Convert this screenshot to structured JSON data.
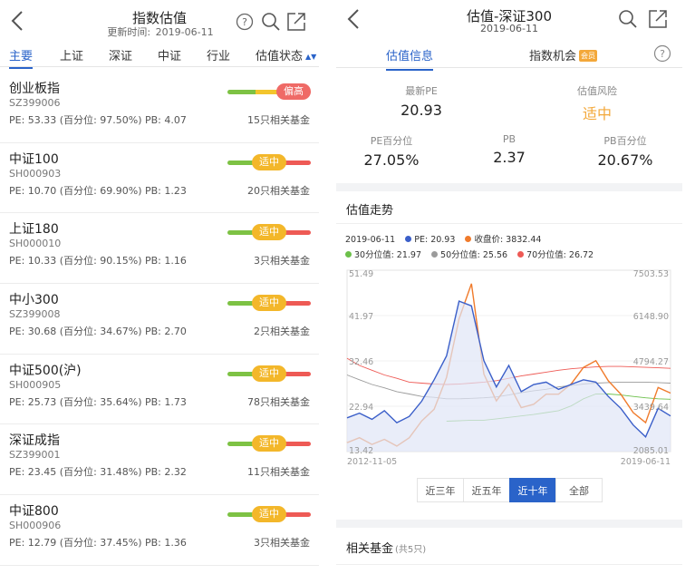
{
  "left": {
    "title": "指数估值",
    "update_label": "更新时间:",
    "update_date": "2019-06-11",
    "tabs": [
      {
        "label": "主要",
        "active": true
      },
      {
        "label": "上证"
      },
      {
        "label": "深证"
      },
      {
        "label": "中证"
      },
      {
        "label": "行业"
      },
      {
        "label": "估值状态"
      }
    ],
    "items": [
      {
        "name": "创业板指",
        "code": "SZ399006",
        "stats": "PE: 53.33 (百分位: 97.50%) PB: 4.07",
        "funds": "15只相关基金",
        "status": "偏高",
        "level": "high"
      },
      {
        "name": "中证100",
        "code": "SH000903",
        "stats": "PE: 10.70 (百分位: 69.90%) PB: 1.23",
        "funds": "20只相关基金",
        "status": "适中",
        "level": "mid"
      },
      {
        "name": "上证180",
        "code": "SH000010",
        "stats": "PE: 10.33 (百分位: 90.15%) PB: 1.16",
        "funds": "3只相关基金",
        "status": "适中",
        "level": "mid"
      },
      {
        "name": "中小300",
        "code": "SZ399008",
        "stats": "PE: 30.68 (百分位: 34.67%) PB: 2.70",
        "funds": "2只相关基金",
        "status": "适中",
        "level": "mid"
      },
      {
        "name": "中证500(沪)",
        "code": "SH000905",
        "stats": "PE: 25.73 (百分位: 35.64%) PB: 1.73",
        "funds": "78只相关基金",
        "status": "适中",
        "level": "mid"
      },
      {
        "name": "深证成指",
        "code": "SZ399001",
        "stats": "PE: 23.45 (百分位: 31.48%) PB: 2.32",
        "funds": "11只相关基金",
        "status": "适中",
        "level": "mid"
      },
      {
        "name": "中证800",
        "code": "SH000906",
        "stats": "PE: 12.79 (百分位: 37.45%) PB: 1.36",
        "funds": "3只相关基金",
        "status": "适中",
        "level": "mid"
      }
    ]
  },
  "right": {
    "title": "估值-深证300",
    "date": "2019-06-11",
    "tabs": [
      {
        "label": "估值信息",
        "active": true
      },
      {
        "label": "指数机会",
        "badge": "会员"
      }
    ],
    "metrics": {
      "latest_pe_label": "最新PE",
      "latest_pe": "20.93",
      "risk_label": "估值风险",
      "risk": "适中",
      "pe_pct_label": "PE百分位",
      "pe_pct": "27.05%",
      "pb_label": "PB",
      "pb": "2.37",
      "pb_pct_label": "PB百分位",
      "pb_pct": "20.67%"
    },
    "trend_title": "估值走势",
    "legend": {
      "date": "2019-06-11",
      "pe": "PE:  20.93",
      "close": "收盘价:  3832.44",
      "p30": "30分位值:  21.97",
      "p50": "50分位值:  25.56",
      "p70": "70分位值:  26.72"
    },
    "periods": [
      {
        "label": "近三年"
      },
      {
        "label": "近五年"
      },
      {
        "label": "近十年",
        "active": true
      },
      {
        "label": "全部"
      }
    ],
    "related_title": "相关基金",
    "related_count": "(共5只)"
  },
  "colors": {
    "accent": "#2a63c9",
    "pe": "#3b5fc9",
    "close": "#f07b2c",
    "p30": "#6cc04a",
    "p50": "#9b9b9b",
    "p70": "#ee5a55"
  },
  "chart_data": {
    "type": "line",
    "x_start": "2012-11-05",
    "x_end": "2019-06-11",
    "y_left_ticks": [
      "51.49",
      "41.97",
      "32.46",
      "22.94",
      "13.42"
    ],
    "y_right_ticks": [
      "7503.53",
      "6148.90",
      "4794.27",
      "3439.64",
      "2085.01"
    ],
    "ylim_left": [
      13.42,
      51.49
    ],
    "ylim_right": [
      2085.01,
      7503.53
    ],
    "x": [
      "2012-11",
      "2013-03",
      "2013-07",
      "2013-11",
      "2014-03",
      "2014-07",
      "2014-11",
      "2015-01",
      "2015-03",
      "2015-05",
      "2015-06",
      "2015-07",
      "2015-09",
      "2015-12",
      "2016-03",
      "2016-07",
      "2016-11",
      "2017-03",
      "2017-07",
      "2017-11",
      "2018-01",
      "2018-04",
      "2018-07",
      "2018-10",
      "2019-01",
      "2019-04",
      "2019-06"
    ],
    "series": [
      {
        "name": "PE",
        "axis": "left",
        "values": [
          20.5,
          21.5,
          20.2,
          22.0,
          19.5,
          20.8,
          24.0,
          28.5,
          33.5,
          45.0,
          44.0,
          32.5,
          27.0,
          31.5,
          26.0,
          27.5,
          28.0,
          26.5,
          27.5,
          28.5,
          28.0,
          25.0,
          22.5,
          19.0,
          16.5,
          22.5,
          20.9
        ]
      },
      {
        "name": "收盘价",
        "axis": "right",
        "values": [
          2350,
          2500,
          2300,
          2450,
          2250,
          2500,
          3000,
          3350,
          4300,
          6050,
          7100,
          4400,
          3600,
          4100,
          3400,
          3500,
          3800,
          3800,
          4100,
          4600,
          4800,
          4200,
          3800,
          3250,
          2950,
          4000,
          3832
        ]
      },
      {
        "name": "30分位值",
        "axis": "left",
        "values": [
          null,
          null,
          null,
          null,
          null,
          null,
          null,
          null,
          19.8,
          19.9,
          20.0,
          20.0,
          20.3,
          20.6,
          20.9,
          21.2,
          21.6,
          22.0,
          23.0,
          24.5,
          25.5,
          25.5,
          25.3,
          25.0,
          24.7,
          24.5,
          24.4
        ]
      },
      {
        "name": "50分位值",
        "axis": "left",
        "values": [
          29.5,
          28.5,
          27.5,
          26.8,
          26.0,
          25.5,
          25.0,
          24.8,
          24.5,
          24.5,
          24.6,
          24.7,
          24.9,
          25.3,
          25.8,
          26.2,
          26.5,
          27.0,
          27.3,
          27.6,
          27.8,
          27.9,
          28.0,
          28.0,
          28.0,
          27.9,
          27.8
        ]
      },
      {
        "name": "70分位值",
        "axis": "left",
        "values": [
          33.0,
          31.5,
          30.5,
          29.5,
          28.8,
          28.0,
          27.8,
          27.6,
          27.5,
          27.6,
          27.8,
          28.0,
          28.3,
          28.8,
          29.3,
          29.7,
          30.1,
          30.5,
          30.8,
          31.0,
          31.2,
          31.3,
          31.3,
          31.2,
          31.1,
          31.0,
          30.9
        ]
      }
    ]
  }
}
